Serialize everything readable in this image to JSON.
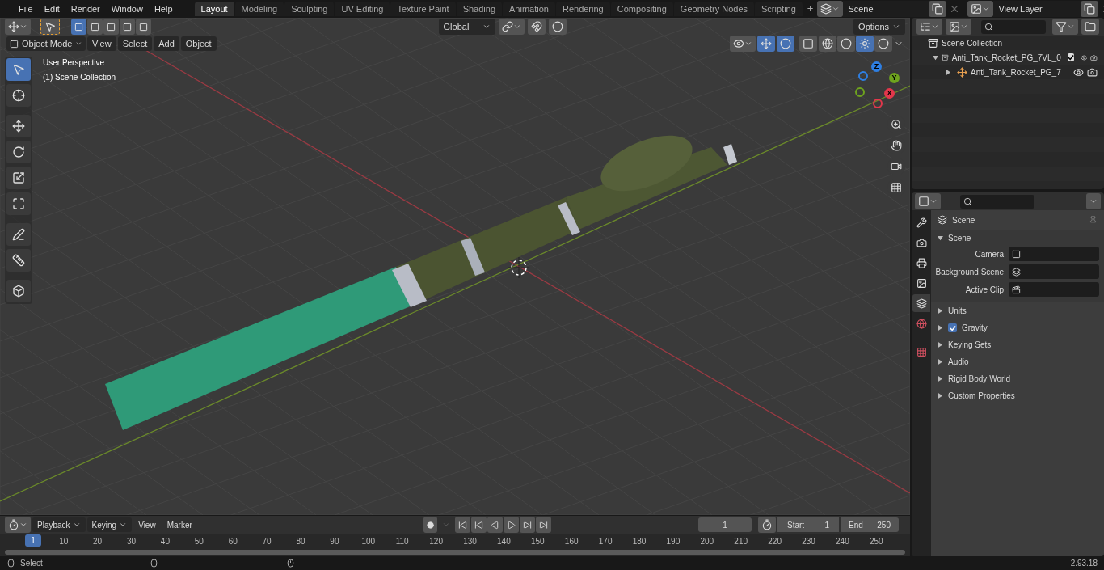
{
  "menu": [
    "File",
    "Edit",
    "Render",
    "Window",
    "Help"
  ],
  "workspaces": [
    {
      "label": "Layout",
      "selected": true
    },
    {
      "label": "Modeling",
      "selected": false
    },
    {
      "label": "Sculpting",
      "selected": false
    },
    {
      "label": "UV Editing",
      "selected": false
    },
    {
      "label": "Texture Paint",
      "selected": false
    },
    {
      "label": "Shading",
      "selected": false
    },
    {
      "label": "Animation",
      "selected": false
    },
    {
      "label": "Rendering",
      "selected": false
    },
    {
      "label": "Compositing",
      "selected": false
    },
    {
      "label": "Geometry Nodes",
      "selected": false
    },
    {
      "label": "Scripting",
      "selected": false
    }
  ],
  "add_workspace": "+",
  "scene": {
    "value": "Scene"
  },
  "view_layer": {
    "value": "View Layer"
  },
  "viewport": {
    "select_modes": [
      {
        "selected": true
      },
      {
        "selected": false
      },
      {
        "selected": false
      },
      {
        "selected": false
      },
      {
        "selected": false
      }
    ],
    "orientation": "Global",
    "options": "Options",
    "mode": "Object Mode",
    "menus": [
      "View",
      "Select",
      "Add",
      "Object"
    ],
    "shading": [
      {
        "selected": false
      },
      {
        "selected": false
      },
      {
        "selected": true
      },
      {
        "selected": false
      }
    ],
    "overlay_lines": [
      "User Perspective",
      "(1) Scene Collection"
    ],
    "tools": [
      {
        "selected": true
      },
      {
        "selected": false
      },
      {
        "selected": false
      },
      {
        "selected": false
      },
      {
        "selected": false
      },
      {
        "selected": false
      },
      {
        "selected": false
      },
      {
        "selected": false
      },
      {
        "selected": false
      }
    ],
    "gizmo_axes": [
      {
        "label": "Z",
        "color": "#2e7fe3"
      },
      {
        "label": "Y",
        "color": "#6ea31e"
      },
      {
        "label": "X",
        "color": "#e2374b"
      }
    ]
  },
  "outliner": {
    "root": "Scene Collection",
    "items": [
      {
        "label": "Anti_Tank_Rocket_PG_7VL_0",
        "expanded": true,
        "checked": true,
        "children": [
          {
            "label": "Anti_Tank_Rocket_PG_7",
            "expanded": false
          }
        ]
      }
    ]
  },
  "properties": {
    "tabs": [
      {
        "selected": false
      },
      {
        "selected": false
      },
      {
        "selected": false
      },
      {
        "selected": false
      },
      {
        "selected": true
      },
      {
        "selected": false
      },
      {
        "selected": false
      }
    ],
    "context": "Scene",
    "panel": {
      "title": "Scene",
      "expanded": true,
      "fields": [
        {
          "label": "Camera"
        },
        {
          "label": "Background Scene"
        },
        {
          "label": "Active Clip"
        }
      ]
    },
    "sections": [
      {
        "label": "Units",
        "kind": "plain",
        "expanded": false
      },
      {
        "label": "Gravity",
        "kind": "checkbox",
        "checked": true,
        "expanded": false
      },
      {
        "label": "Keying Sets",
        "kind": "plain",
        "expanded": false
      },
      {
        "label": "Audio",
        "kind": "plain",
        "expanded": false
      },
      {
        "label": "Rigid Body World",
        "kind": "plain",
        "expanded": false
      },
      {
        "label": "Custom Properties",
        "kind": "plain",
        "expanded": false
      }
    ]
  },
  "timeline": {
    "menus": [
      {
        "label": "Playback",
        "kind": "dropdown"
      },
      {
        "label": "Keying",
        "kind": "dropdown"
      },
      {
        "label": "View",
        "kind": "menu"
      },
      {
        "label": "Marker",
        "kind": "menu"
      }
    ],
    "current_frame": "1",
    "start": {
      "label": "Start",
      "value": "1"
    },
    "end": {
      "label": "End",
      "value": "250"
    },
    "ruler": {
      "current": "1",
      "ticks": [
        "10",
        "20",
        "30",
        "40",
        "50",
        "60",
        "70",
        "80",
        "90",
        "100",
        "110",
        "120",
        "130",
        "140",
        "150",
        "160",
        "170",
        "180",
        "190",
        "200",
        "210",
        "220",
        "230",
        "240",
        "250"
      ]
    }
  },
  "status": {
    "hint": "Select",
    "version": "2.93.18"
  }
}
